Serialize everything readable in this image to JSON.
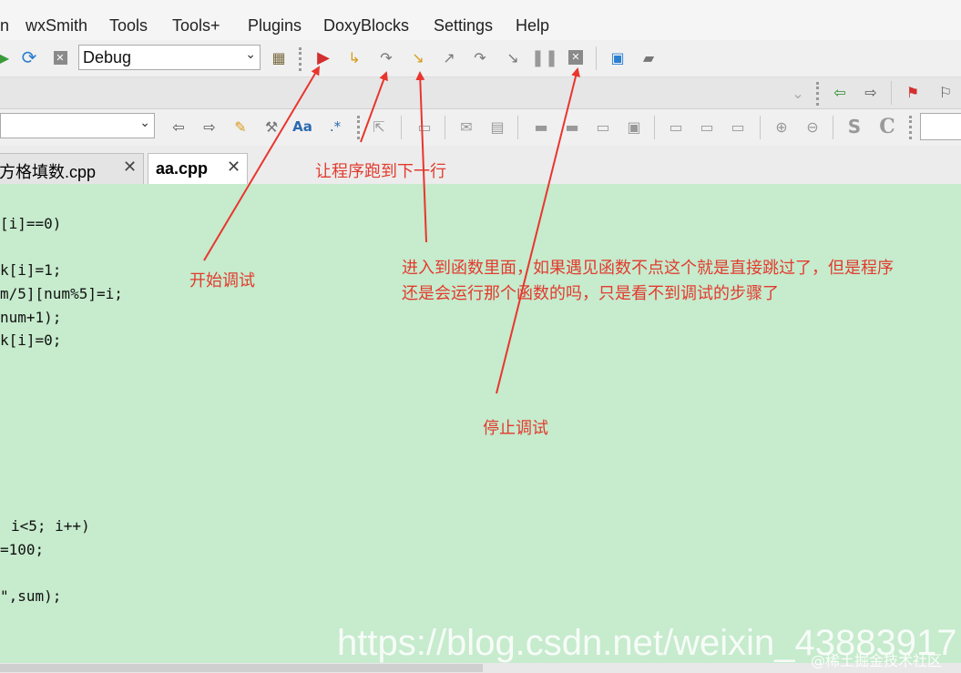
{
  "menu": [
    "n",
    "wxSmith",
    "Tools",
    "Tools+",
    "Plugins",
    "DoxyBlocks",
    "Settings",
    "Help"
  ],
  "toolbar": {
    "build_target": "Debug"
  },
  "tabs": [
    {
      "label": "方格填数.cpp",
      "close": "✕"
    },
    {
      "label": "aa.cpp",
      "close": "✕"
    }
  ],
  "code_lines": [
    "[i]==0)",
    "k[i]=1;",
    "m/5][num%5]=i;",
    "num+1);",
    "k[i]=0;",
    "i<5; i++)",
    "=100;",
    "\",sum);"
  ],
  "annotations": {
    "start_debug": "开始调试",
    "next_line": "让程序跑到下一行",
    "step_into_line1": "进入到函数里面，如果遇见函数不点这个就是直接跳过了，但是程序",
    "step_into_line2": "还是会运行那个函数的吗，只是看不到调试的步骤了",
    "stop_debug": "停止调试"
  },
  "watermark": "https://blog.csdn.net/weixin_43883917",
  "watermark2": "@稀土掘金技术社区",
  "colors": {
    "editor_bg": "#c6ebcd",
    "annotation": "#e23b2e",
    "debug_run": "#d32f2f"
  },
  "icons": [
    "build-run-icon",
    "rebuild-icon",
    "abort-icon",
    "build-options-icon",
    "debug-start-icon",
    "run-to-cursor-icon",
    "next-line-icon",
    "step-into-icon",
    "step-out-icon",
    "next-instruction-icon",
    "step-into-instruction-icon",
    "pause-icon",
    "stop-debug-icon",
    "debug-windows-icon",
    "various-info-icon"
  ]
}
